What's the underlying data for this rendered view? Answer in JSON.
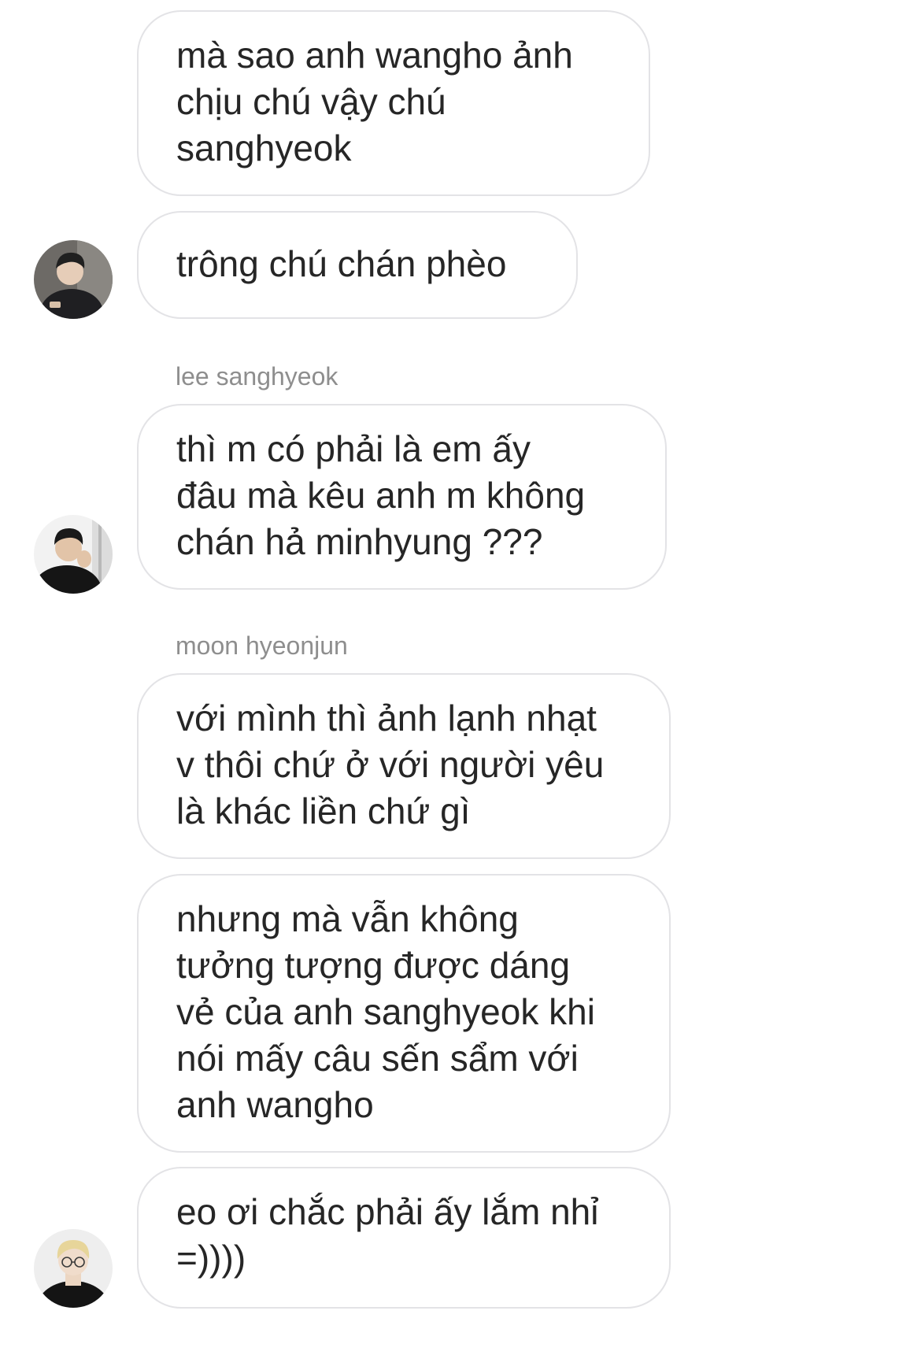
{
  "conversation": {
    "messages": [
      {
        "text": "mà sao anh wangho ảnh\nchịu chú vậy chú\nsanghyeok"
      },
      {
        "text": "trông chú chán phèo"
      },
      {
        "sender": "lee sanghyeok",
        "text": "thì m có phải là em ấy\nđâu mà kêu anh m không\nchán hả minhyung ???"
      },
      {
        "sender": "moon hyeonjun",
        "text": "với mình thì ảnh lạnh nhạt\nv thôi chứ ở với người yêu\nlà khác liền chứ gì"
      },
      {
        "text": "nhưng mà vẫn không\ntưởng tượng được dáng\nvẻ của anh sanghyeok khi\nnói mấy câu sến sẩm với\nanh wangho"
      },
      {
        "text": "eo ơi chắc phải ấy lắm nhỉ\n=))))"
      }
    ],
    "avatars": [
      {
        "icon": "user-avatar-icon"
      },
      {
        "icon": "user-avatar-icon"
      },
      {
        "icon": "user-avatar-icon"
      }
    ]
  },
  "colors": {
    "background": "#ffffff",
    "bubble_border": "#e3e3e6",
    "message_text": "#262626",
    "sender_text": "#8e8e8e"
  }
}
